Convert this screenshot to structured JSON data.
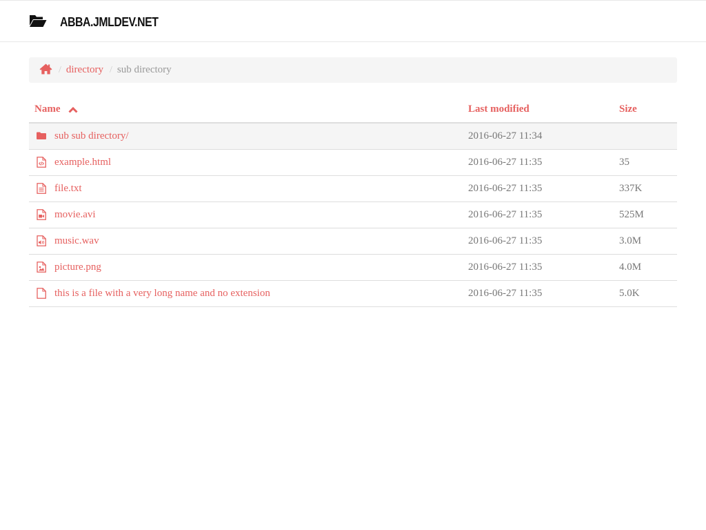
{
  "header": {
    "brand": "ABBA.JMLDEV.NET",
    "brand_icon": "folder-open-icon"
  },
  "breadcrumb": {
    "home_icon": "home-icon",
    "separator": "/",
    "items": [
      {
        "label": "directory",
        "link": true
      },
      {
        "label": "sub directory",
        "link": false
      }
    ]
  },
  "table": {
    "columns": {
      "name": "Name",
      "modified": "Last modified",
      "size": "Size"
    },
    "sort": {
      "column": "name",
      "direction": "ascending",
      "icon": "chevron-up-icon"
    },
    "rows": [
      {
        "name": "sub sub directory/",
        "modified": "2016-06-27 11:34",
        "size": "",
        "icon": "folder-icon"
      },
      {
        "name": "example.html",
        "modified": "2016-06-27 11:35",
        "size": "35",
        "icon": "file-code-icon"
      },
      {
        "name": "file.txt",
        "modified": "2016-06-27 11:35",
        "size": "337K",
        "icon": "file-text-icon"
      },
      {
        "name": "movie.avi",
        "modified": "2016-06-27 11:35",
        "size": "525M",
        "icon": "file-video-icon"
      },
      {
        "name": "music.wav",
        "modified": "2016-06-27 11:35",
        "size": "3.0M",
        "icon": "file-audio-icon"
      },
      {
        "name": "picture.png",
        "modified": "2016-06-27 11:35",
        "size": "4.0M",
        "icon": "file-image-icon"
      },
      {
        "name": "this is a file with a very long name and no extension",
        "modified": "2016-06-27 11:35",
        "size": "5.0K",
        "icon": "file-icon"
      }
    ]
  },
  "colors": {
    "accent": "#e6605f",
    "text": "#777777",
    "muted": "#999999",
    "breadcrumb_bg": "#f5f5f5",
    "border": "#dddddd"
  }
}
